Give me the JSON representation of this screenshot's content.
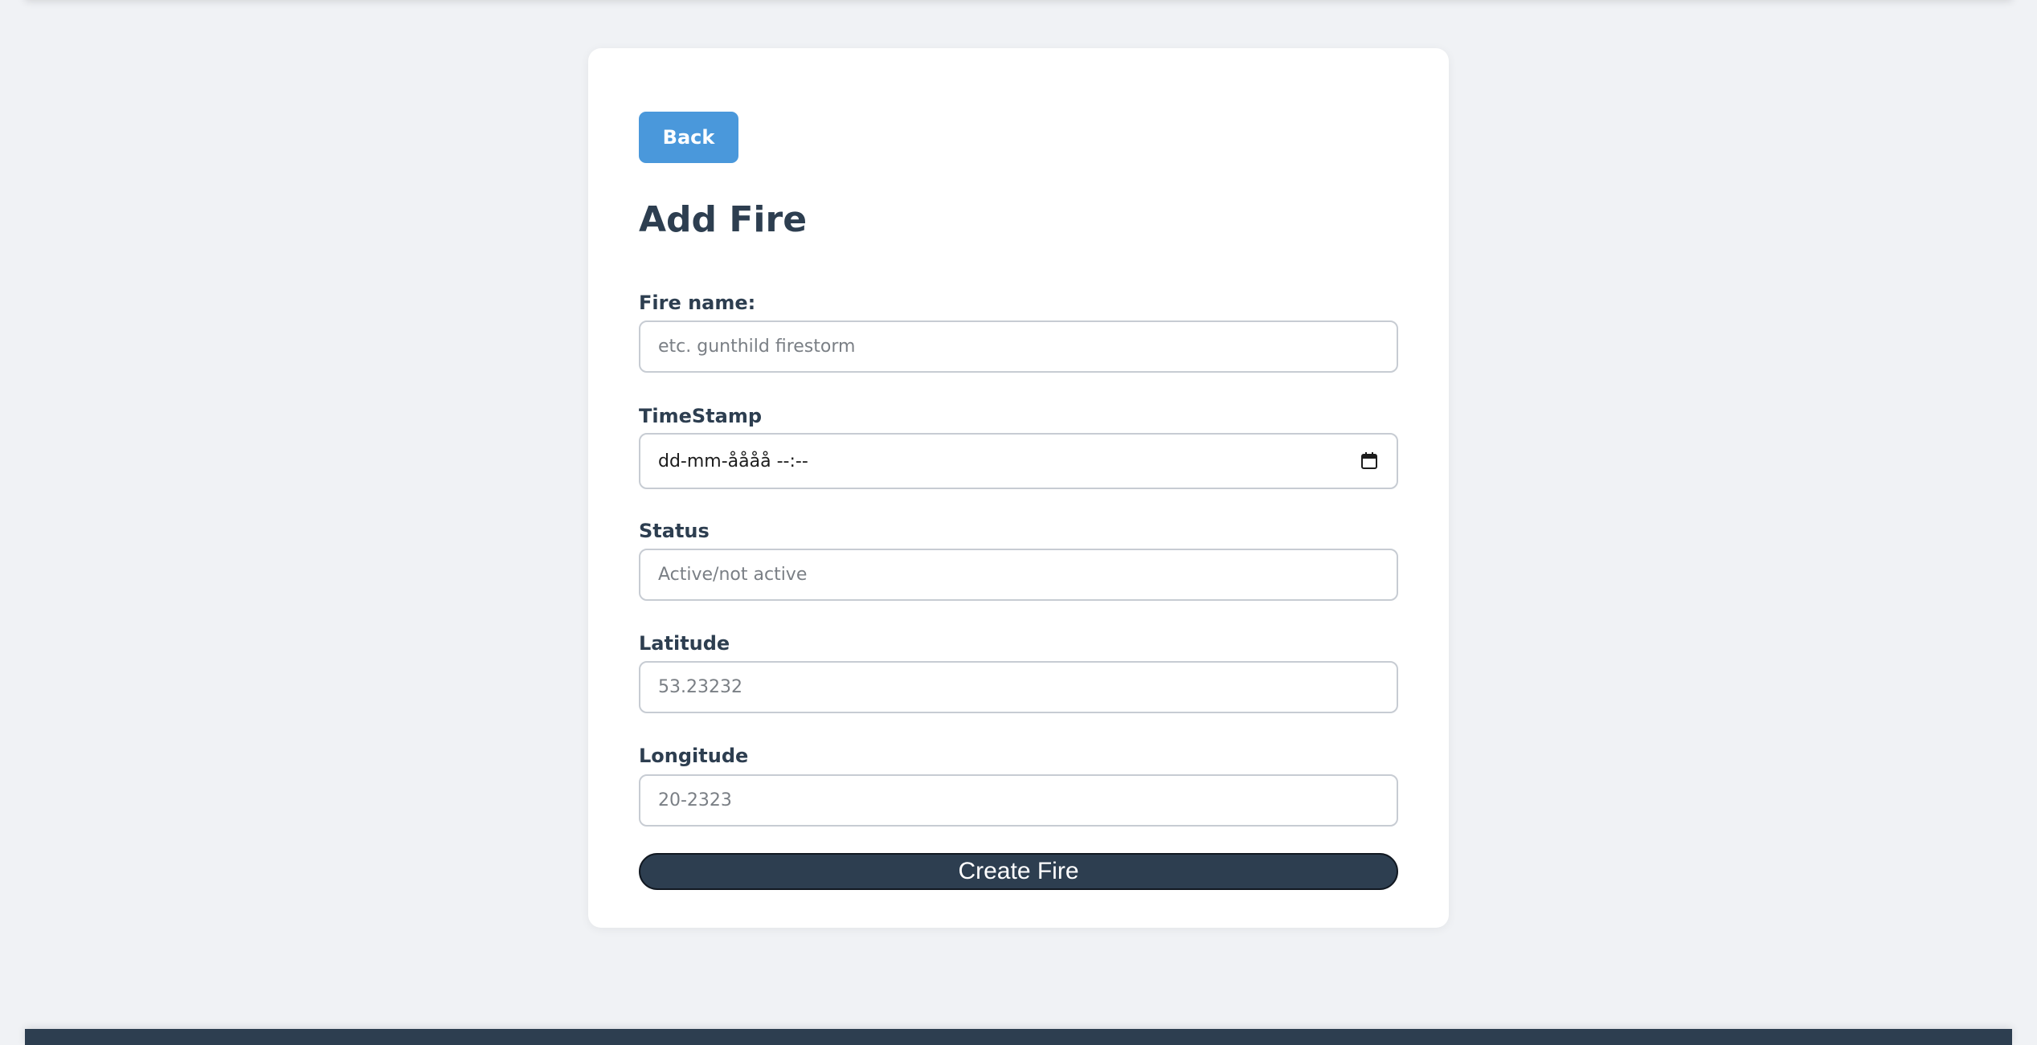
{
  "form": {
    "back_label": "Back",
    "title": "Add Fire",
    "fire_name": {
      "label": "Fire name:",
      "placeholder": "etc. gunthild firestorm",
      "value": ""
    },
    "timestamp": {
      "label": "TimeStamp",
      "display": "dd-mm-åååå --:--",
      "icon": "calendar-icon"
    },
    "status": {
      "label": "Status",
      "placeholder": "Active/not active",
      "value": ""
    },
    "latitude": {
      "label": "Latitude",
      "placeholder": "53.23232",
      "value": ""
    },
    "longitude": {
      "label": "Longitude",
      "placeholder": "20-2323",
      "value": ""
    },
    "submit_label": "Create Fire"
  },
  "colors": {
    "background": "#f0f2f5",
    "card": "#ffffff",
    "text": "#2d3e50",
    "accent": "#4a98db",
    "submit": "#2d3e50",
    "footer": "#2d3e50"
  }
}
